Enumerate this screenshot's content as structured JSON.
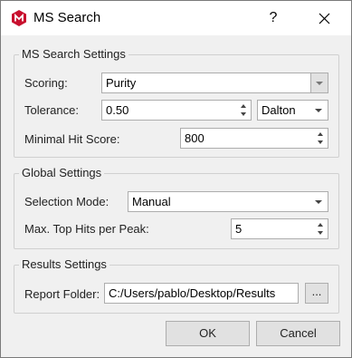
{
  "window": {
    "title": "MS Search",
    "help_label": "?",
    "icons": {
      "app": "app-logo-icon",
      "close": "close-icon"
    }
  },
  "ms_search_settings": {
    "title": "MS Search Settings",
    "scoring_label": "Scoring:",
    "scoring_value": "Purity",
    "tolerance_label": "Tolerance:",
    "tolerance_value": "0.50",
    "tolerance_unit": "Dalton",
    "min_hit_score_label": "Minimal Hit Score:",
    "min_hit_score_value": "800"
  },
  "global_settings": {
    "title": "Global Settings",
    "selection_mode_label": "Selection Mode:",
    "selection_mode_value": "Manual",
    "max_top_hits_label": "Max. Top Hits per Peak:",
    "max_top_hits_value": "5"
  },
  "results_settings": {
    "title": "Results Settings",
    "report_folder_label": "Report Folder:",
    "report_folder_value": "C:/Users/pablo/Desktop/Results",
    "browse_label": "..."
  },
  "buttons": {
    "ok": "OK",
    "cancel": "Cancel"
  },
  "colors": {
    "app_icon": "#c8102e",
    "background": "#f0f0f0",
    "titlebar": "#ffffff"
  }
}
